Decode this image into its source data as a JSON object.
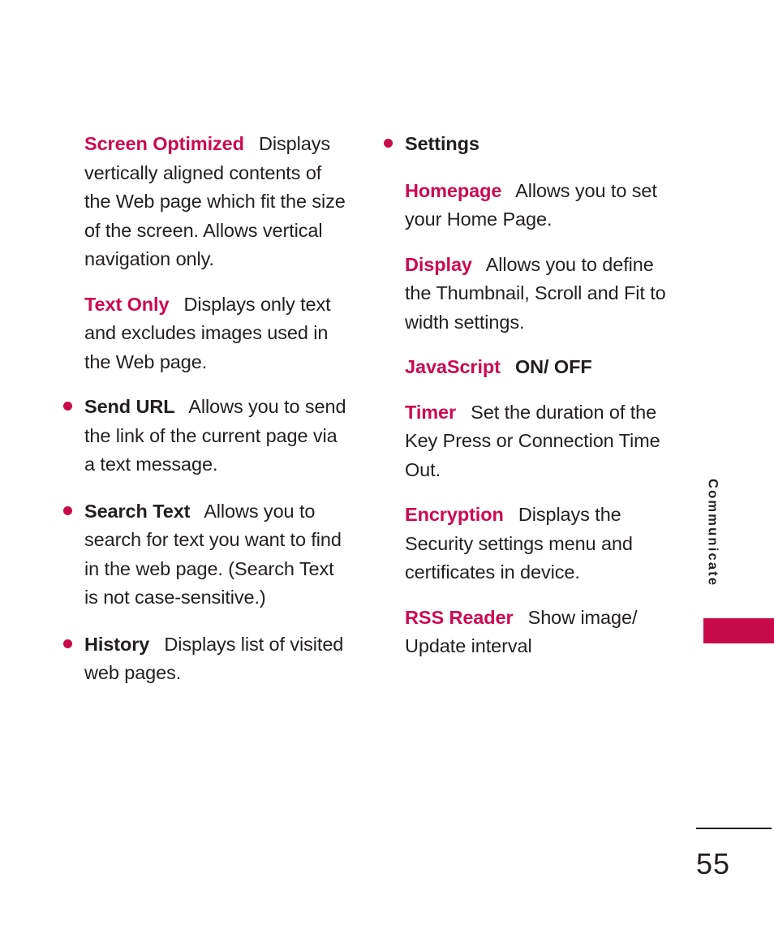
{
  "page": {
    "number": "55",
    "section_tab_label": "Communicate",
    "accent_color": "#c80a4b",
    "term_color": "#cc0a50",
    "text_color": "#231f20"
  },
  "left_column": {
    "items": [
      {
        "kind": "sub",
        "bullet": false,
        "term": "Screen Optimized",
        "term_style": "accent",
        "body": "Displays vertically aligned contents of the Web page which fit the size of the screen. Allows vertical navigation only."
      },
      {
        "kind": "sub",
        "bullet": false,
        "term": "Text Only",
        "term_style": "accent",
        "body": "Displays only text and excludes images used in the Web page."
      },
      {
        "kind": "bullet",
        "bullet": true,
        "term": "Send URL",
        "term_style": "dark",
        "body": "Allows you to send the link of the current page via a text message."
      },
      {
        "kind": "bullet",
        "bullet": true,
        "term": "Search Text",
        "term_style": "dark",
        "body": "Allows  you to search for text you want to find in the web page. (Search Text is not case-sensitive.)"
      },
      {
        "kind": "bullet",
        "bullet": true,
        "term": "History",
        "term_style": "dark",
        "body": "Displays list of visited web pages."
      }
    ]
  },
  "right_column": {
    "items": [
      {
        "kind": "bullet",
        "bullet": true,
        "term": "Settings",
        "term_style": "dark",
        "body": ""
      },
      {
        "kind": "sub",
        "bullet": false,
        "term": "Homepage",
        "term_style": "accent",
        "body": "Allows you to set your Home Page."
      },
      {
        "kind": "sub",
        "bullet": false,
        "term": "Display",
        "term_style": "accent",
        "body": "Allows you to define the Thumbnail, Scroll and Fit to width settings."
      },
      {
        "kind": "sub",
        "bullet": false,
        "term": "JavaScript",
        "term_style": "accent",
        "body": "ON/ OFF",
        "body_style": "bold"
      },
      {
        "kind": "sub",
        "bullet": false,
        "term": "Timer",
        "term_style": "accent",
        "body": "Set the duration of the Key Press or Connection Time Out."
      },
      {
        "kind": "sub",
        "bullet": false,
        "term": "Encryption",
        "term_style": "accent",
        "body": "Displays the Security settings menu and certificates in device."
      },
      {
        "kind": "sub",
        "bullet": false,
        "term": "RSS Reader",
        "term_style": "accent",
        "body": "Show image/ Update interval"
      }
    ]
  }
}
